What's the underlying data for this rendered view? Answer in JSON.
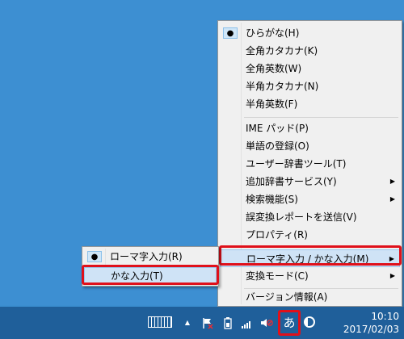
{
  "menu": {
    "items": [
      {
        "label": "ひらがな(H)",
        "checked": true
      },
      {
        "label": "全角カタカナ(K)"
      },
      {
        "label": "全角英数(W)"
      },
      {
        "label": "半角カタカナ(N)"
      },
      {
        "label": "半角英数(F)"
      },
      {
        "label": "IME パッド(P)"
      },
      {
        "label": "単語の登録(O)"
      },
      {
        "label": "ユーザー辞書ツール(T)"
      },
      {
        "label": "追加辞書サービス(Y)",
        "submenu": true
      },
      {
        "label": "検索機能(S)",
        "submenu": true
      },
      {
        "label": "誤変換レポートを送信(V)"
      },
      {
        "label": "プロパティ(R)"
      },
      {
        "label": "ローマ字入力 / かな入力(M)",
        "submenu": true,
        "highlighted": true
      },
      {
        "label": "変換モード(C)",
        "submenu": true
      },
      {
        "label": "バージョン情報(A)"
      }
    ]
  },
  "submenu": {
    "items": [
      {
        "label": "ローマ字入力(R)",
        "checked": true
      },
      {
        "label": "かな入力(T)",
        "highlighted": true
      }
    ]
  },
  "glyphs": {
    "bullet": "●",
    "arrow": "▶",
    "tray_up": "▲"
  },
  "taskbar": {
    "ime_mode_label": "あ",
    "time": "10:10",
    "date": "2017/02/03"
  },
  "colors": {
    "highlight_box": "#e0101a",
    "taskbar": "#1f5f9a",
    "desktop": "#3d8fd2"
  }
}
